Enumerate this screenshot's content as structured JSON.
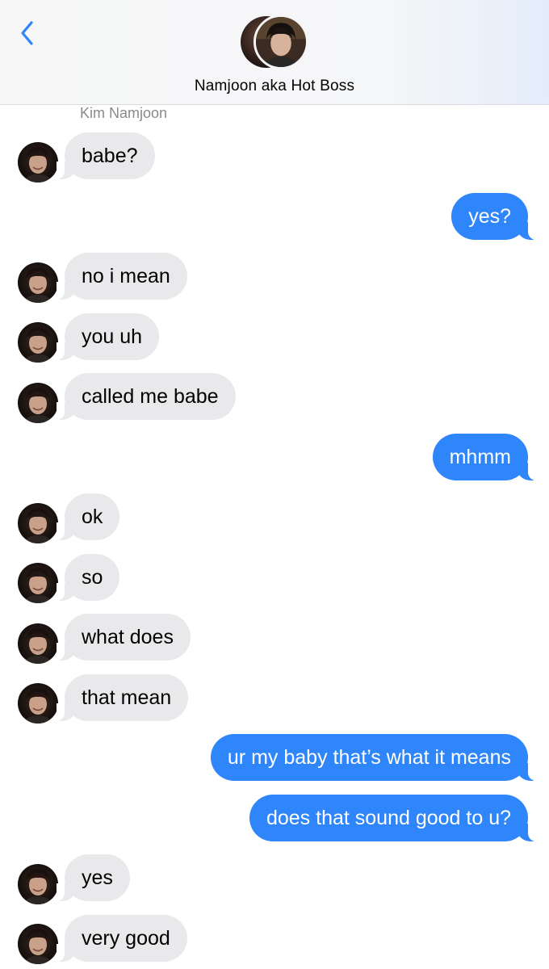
{
  "header": {
    "back_icon": "chevron-left-icon",
    "accent_color": "#2f85fa",
    "contact_name": "Namjoon aka Hot Boss"
  },
  "thread": {
    "sender_label": "Kim Namjoon",
    "incoming_bubble_color": "#e9e9eb",
    "outgoing_bubble_color": "#2f85fa",
    "messages": [
      {
        "direction": "in",
        "text": "babe?"
      },
      {
        "direction": "out",
        "text": "yes?"
      },
      {
        "direction": "in",
        "text": "no i mean"
      },
      {
        "direction": "in",
        "text": "you uh"
      },
      {
        "direction": "in",
        "text": "called me babe"
      },
      {
        "direction": "out",
        "text": "mhmm"
      },
      {
        "direction": "in",
        "text": "ok"
      },
      {
        "direction": "in",
        "text": "so"
      },
      {
        "direction": "in",
        "text": "what does"
      },
      {
        "direction": "in",
        "text": "that mean"
      },
      {
        "direction": "out",
        "text": "ur my baby that’s what it means"
      },
      {
        "direction": "out",
        "text": "does that sound good to u?"
      },
      {
        "direction": "in",
        "text": "yes"
      },
      {
        "direction": "in",
        "text": "very good"
      }
    ]
  }
}
